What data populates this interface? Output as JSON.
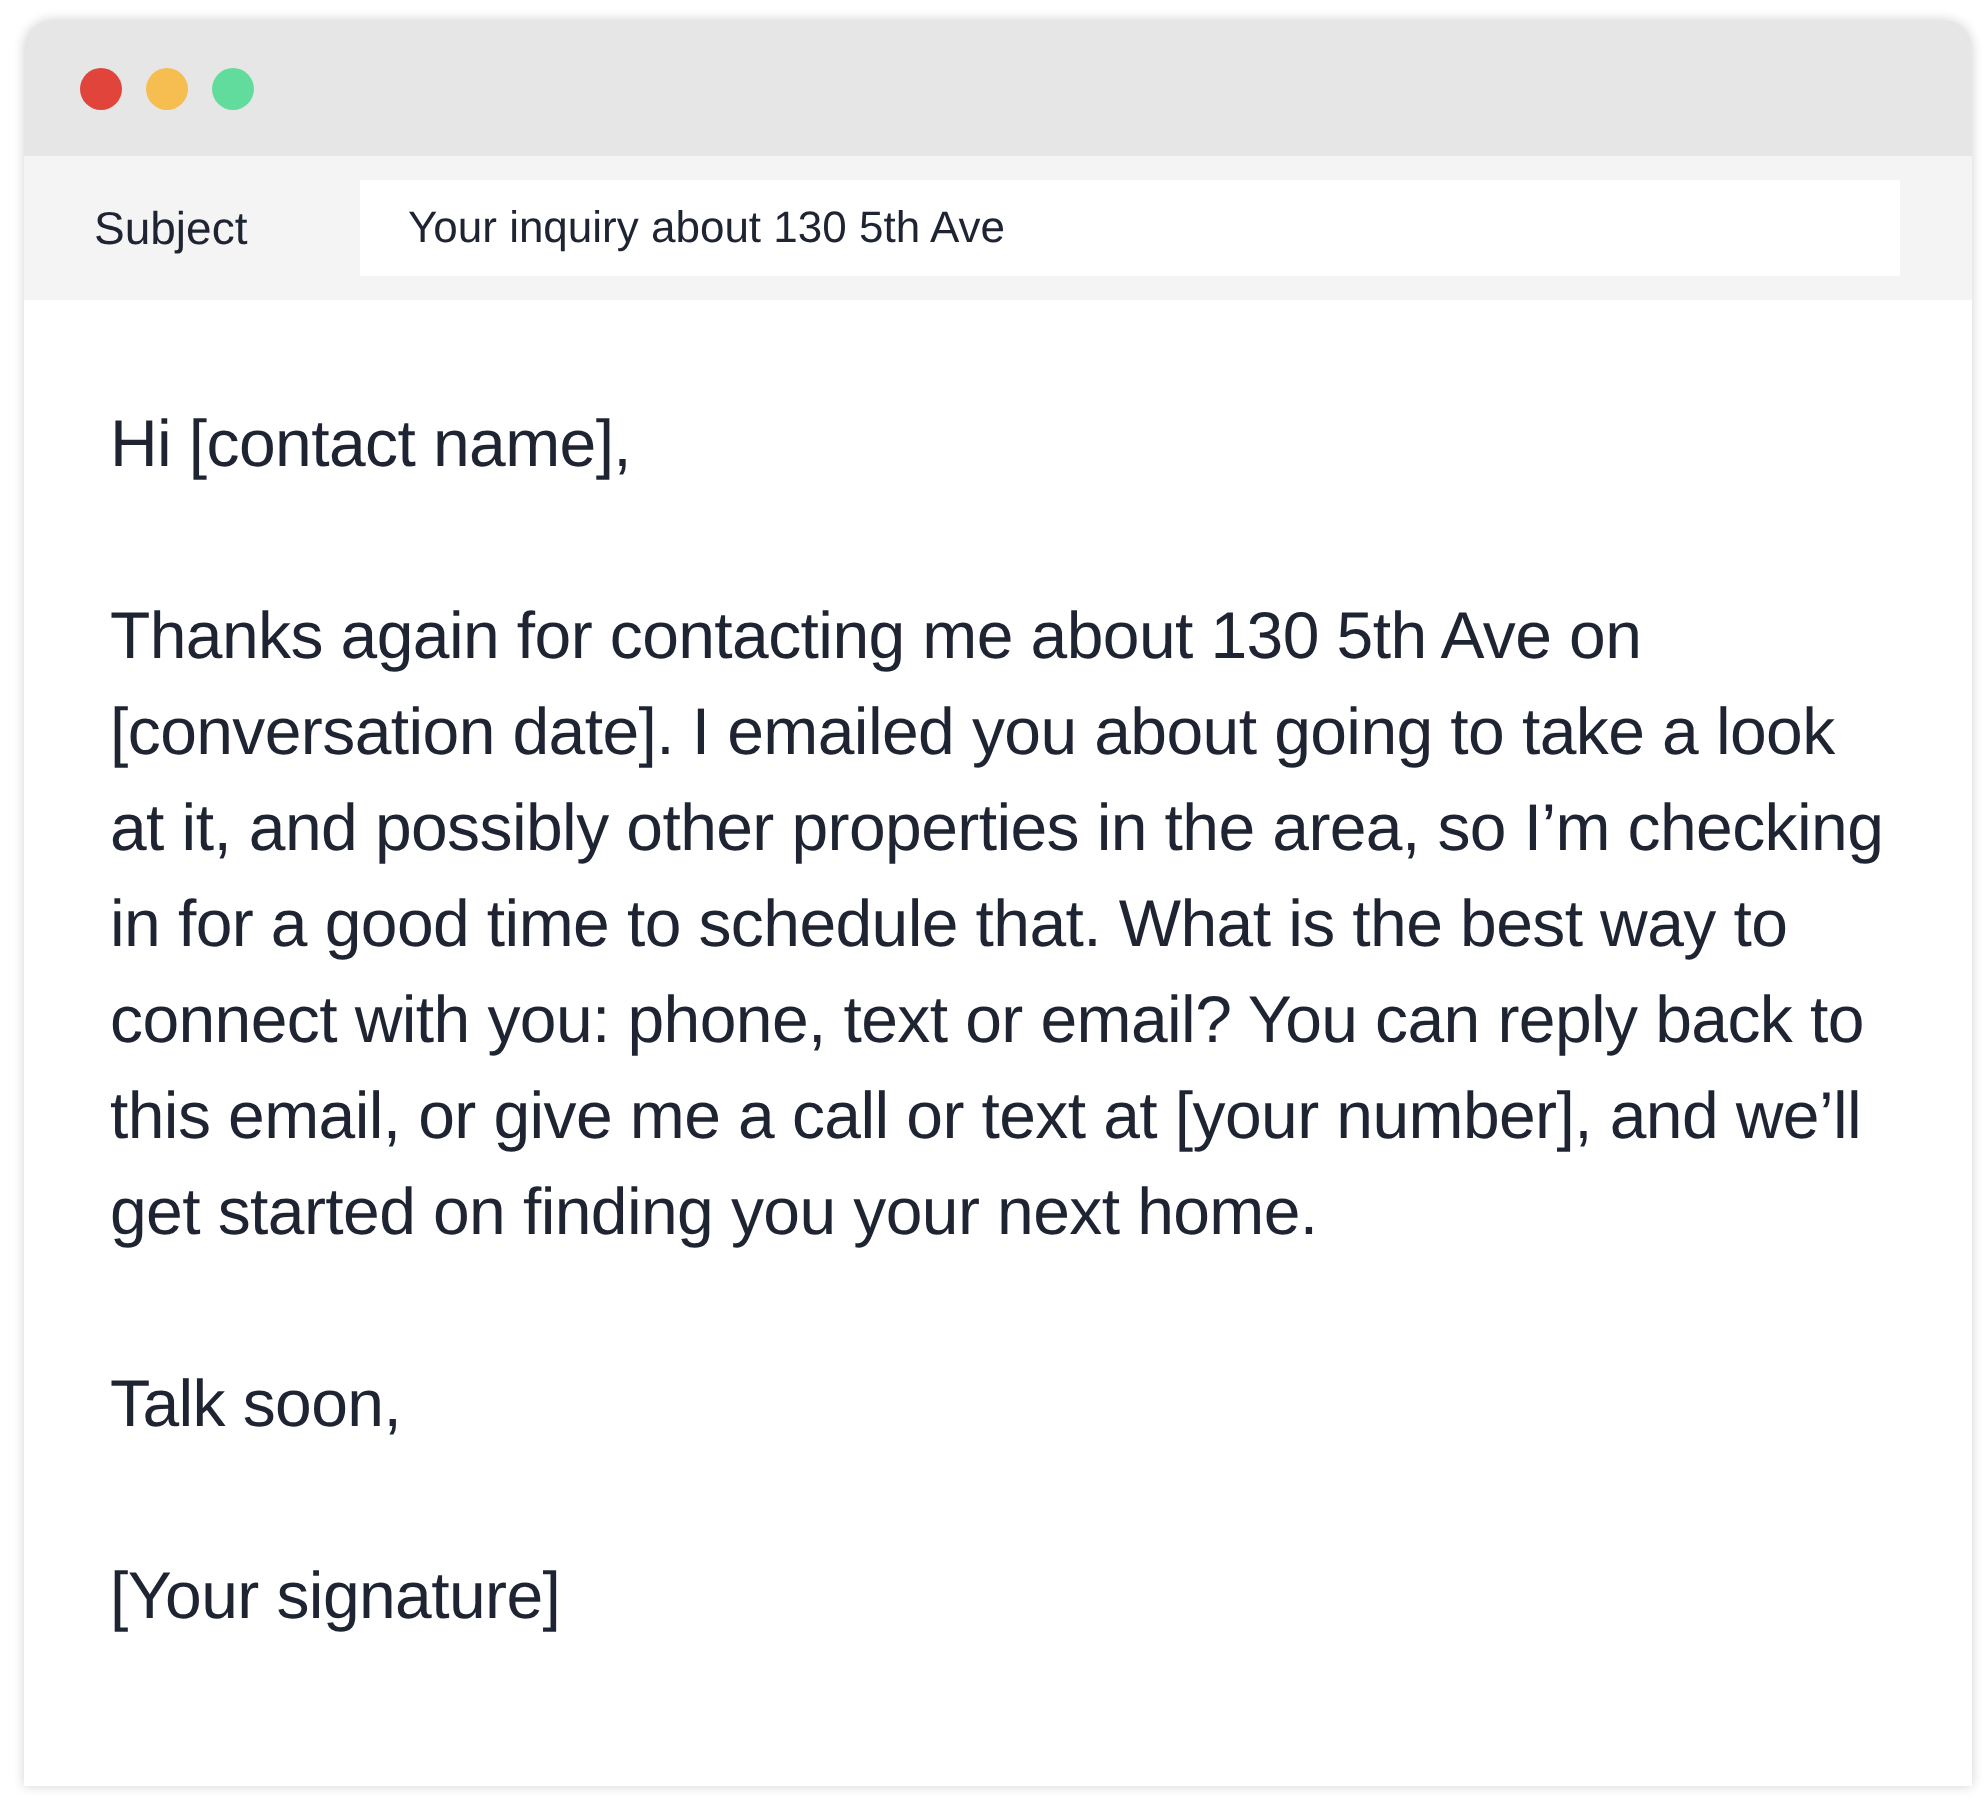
{
  "window": {
    "controls": [
      {
        "color": "#e0443a"
      },
      {
        "color": "#f6bd50"
      },
      {
        "color": "#62dc9c"
      }
    ]
  },
  "subject": {
    "label": "Subject",
    "value": "Your inquiry about 130 5th Ave"
  },
  "body": {
    "paragraphs": [
      "Hi [contact name],",
      "Thanks again for contacting me about 130 5th Ave on [conversation date]. I emailed you about going to take a look at it, and possibly other properties in the area, so I’m checking in for a good time to schedule that. What is the best way to connect with you: phone, text or email? You can reply back to this email, or give me a call or text at [your number], and we’ll get started on finding you your next home.",
      "Talk soon,",
      "[Your signature]"
    ]
  }
}
